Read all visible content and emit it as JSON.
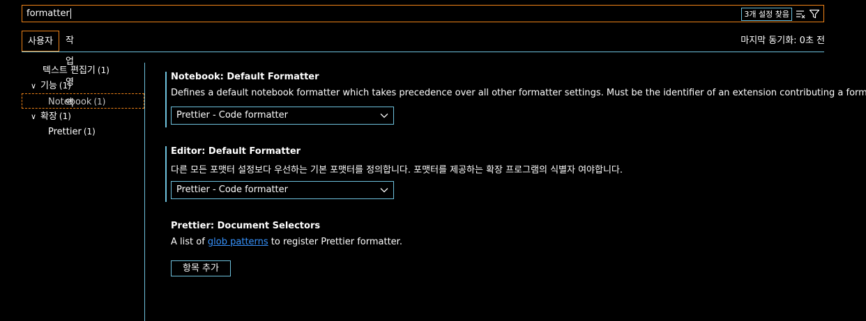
{
  "search": {
    "value": "formatter",
    "result_count": "3개 설정 찾음"
  },
  "icons": {
    "clear": "clear-filter-icon",
    "filter": "filter-icon",
    "chevron": "chevron-down-icon"
  },
  "colors": {
    "focus_border": "#f38518",
    "contrast_border": "#6fc3df",
    "link": "#3794ff",
    "background": "#000000"
  },
  "tabs": {
    "user": "사용자",
    "workspace": "작업 영역",
    "last_synced": "마지막 동기화: 0초 전"
  },
  "toc": {
    "items": [
      {
        "label": "텍스트 편집기",
        "count": "(1)"
      },
      {
        "label": "기능",
        "count": "(1)"
      },
      {
        "label": "Notebook",
        "count": "(1)"
      },
      {
        "label": "확장",
        "count": "(1)"
      },
      {
        "label": "Prettier",
        "count": "(1)"
      }
    ]
  },
  "settings": [
    {
      "title": "Notebook: Default Formatter",
      "description": "Defines a default notebook formatter which takes precedence over all other formatter settings. Must be the identifier of an extension contributing a formatter.",
      "value": "Prettier - Code formatter"
    },
    {
      "title": "Editor: Default Formatter",
      "description": "다른 모든 포맷터 설정보다 우선하는 기본 포맷터를 정의합니다. 포맷터를 제공하는 확장 프로그램의 식별자 여야합니다.",
      "value": "Prettier - Code formatter"
    },
    {
      "title": "Prettier: Document Selectors",
      "description_before": "A list of ",
      "description_link": "glob patterns",
      "description_after": " to register Prettier formatter.",
      "button": "항목 추가"
    }
  ]
}
